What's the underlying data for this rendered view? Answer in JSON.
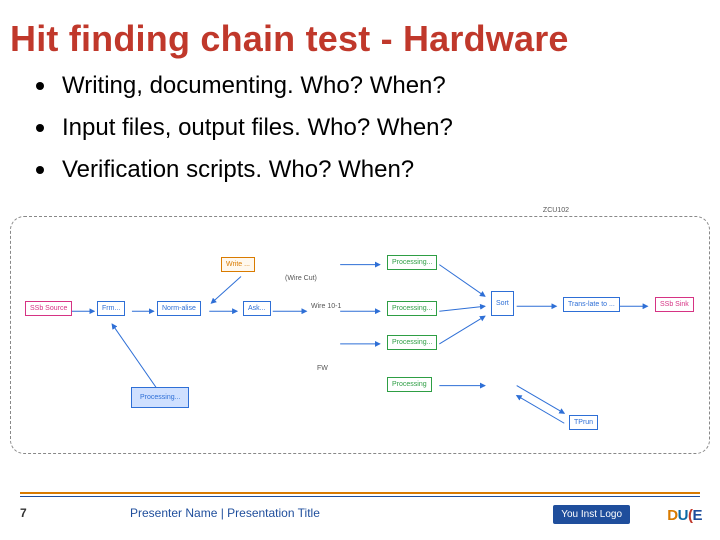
{
  "title": "Hit finding chain test - Hardware",
  "bullets": [
    "Writing, documenting. Who? When?",
    "Input files, output files. Who? When?",
    "Verification scripts. Who? When?"
  ],
  "diagram": {
    "corner_label": "ZCU102",
    "boxes": {
      "source": "SSb Source",
      "frm": "Frm...",
      "normalise": "Norm-alise",
      "write": "Write ...",
      "wire_cut": "(Wire Cut)",
      "ask1": "Ask...",
      "wire_10_1": "Wire 10-1",
      "processing1": "Processing...",
      "processing2": "Processing...",
      "processing3": "Processing...",
      "processing4": "Processing",
      "process_blue": "Processing...",
      "sort": "Sort",
      "trans": "Trans-late to ...",
      "sink": "SSb Sink",
      "tprun": "TPrun",
      "fw": "FW"
    }
  },
  "footer": {
    "page": "7",
    "presenter": "Presenter Name | Presentation Title",
    "inst_logo": "You Inst Logo",
    "dune": {
      "d": "D",
      "u": "U",
      "n": "(",
      "e": "E"
    }
  }
}
